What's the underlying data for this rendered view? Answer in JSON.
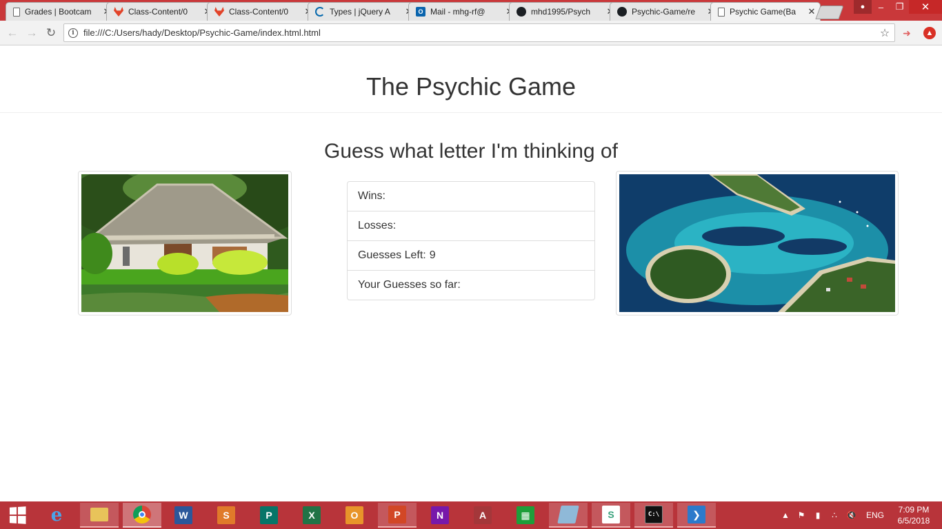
{
  "browser": {
    "tabs": [
      {
        "title": "Grades | Bootcam",
        "favicon": "doc-icon"
      },
      {
        "title": "Class-Content/0",
        "favicon": "gitlab-icon"
      },
      {
        "title": "Class-Content/0",
        "favicon": "gitlab-icon"
      },
      {
        "title": "Types | jQuery A",
        "favicon": "jquery-icon"
      },
      {
        "title": "Mail - mhg-rf@",
        "favicon": "outlook-icon"
      },
      {
        "title": "mhd1995/Psych",
        "favicon": "github-icon"
      },
      {
        "title": "Psychic-Game/re",
        "favicon": "github-icon"
      },
      {
        "title": "Psychic Game(Ba",
        "favicon": "doc-icon",
        "active": true
      }
    ],
    "address": "file:///C:/Users/hady/Desktop/Psychic-Game/index.html.html",
    "accent": "#c9383a"
  },
  "page": {
    "title": "The Psychic Game",
    "subtitle": "Guess what letter I'm thinking of",
    "stats": [
      {
        "label": "Wins:",
        "value": ""
      },
      {
        "label": "Losses:",
        "value": ""
      },
      {
        "label": "Guesses Left:",
        "value": "9"
      },
      {
        "label": "Your Guesses so far:",
        "value": ""
      }
    ],
    "images": {
      "left": "thatched-hut-photo",
      "right": "island-lagoon-photo"
    }
  },
  "taskbar": {
    "apps": [
      "file-explorer",
      "chrome",
      "word",
      "sway",
      "publisher",
      "excel",
      "outlook",
      "powerpoint",
      "onenote",
      "access",
      "store",
      "editor",
      "slack",
      "cmd",
      "vscode"
    ],
    "tray": {
      "language": "ENG",
      "time": "7:09 PM",
      "date": "6/5/2018"
    },
    "color": "#b8343a"
  }
}
